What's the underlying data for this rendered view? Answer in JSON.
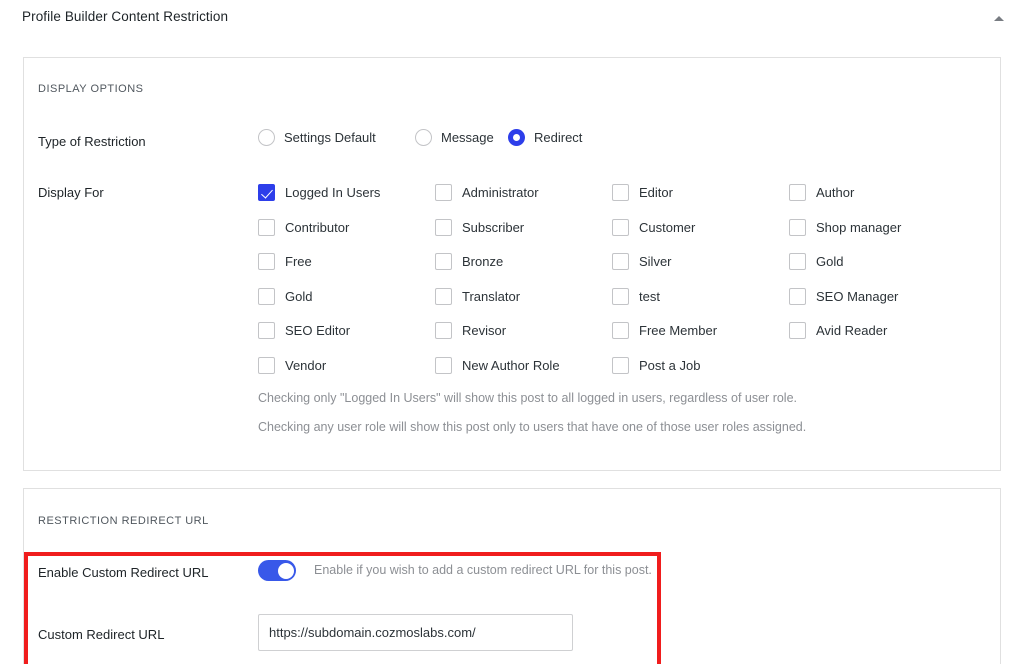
{
  "metabox": {
    "title": "Profile Builder Content Restriction",
    "collapse_icon": "caret-up-icon"
  },
  "display_options": {
    "section_label": "DISPLAY OPTIONS",
    "type_of_restriction": {
      "label": "Type of Restriction",
      "selected": "Redirect",
      "options": [
        {
          "label": "Settings Default",
          "checked": false
        },
        {
          "label": "Message",
          "checked": false
        },
        {
          "label": "Redirect",
          "checked": true
        }
      ]
    },
    "display_for": {
      "label": "Display For",
      "roles": [
        {
          "label": "Logged In Users",
          "checked": true
        },
        {
          "label": "Administrator",
          "checked": false
        },
        {
          "label": "Editor",
          "checked": false
        },
        {
          "label": "Author",
          "checked": false
        },
        {
          "label": "Contributor",
          "checked": false
        },
        {
          "label": "Subscriber",
          "checked": false
        },
        {
          "label": "Customer",
          "checked": false
        },
        {
          "label": "Shop manager",
          "checked": false
        },
        {
          "label": "Free",
          "checked": false
        },
        {
          "label": "Bronze",
          "checked": false
        },
        {
          "label": "Silver",
          "checked": false
        },
        {
          "label": "Gold",
          "checked": false
        },
        {
          "label": "Gold",
          "checked": false
        },
        {
          "label": "Translator",
          "checked": false
        },
        {
          "label": "test",
          "checked": false
        },
        {
          "label": "SEO Manager",
          "checked": false
        },
        {
          "label": "SEO Editor",
          "checked": false
        },
        {
          "label": "Revisor",
          "checked": false
        },
        {
          "label": "Free Member",
          "checked": false
        },
        {
          "label": "Avid Reader",
          "checked": false
        },
        {
          "label": "Vendor",
          "checked": false
        },
        {
          "label": "New Author Role",
          "checked": false
        },
        {
          "label": "Post a Job",
          "checked": false
        }
      ],
      "help_line_1": "Checking only \"Logged In Users\" will show this post to all logged in users, regardless of user role.",
      "help_line_2": "Checking any user role will show this post only to users that have one of those user roles assigned."
    }
  },
  "restriction_redirect_url": {
    "section_label": "RESTRICTION REDIRECT URL",
    "enable_custom_redirect": {
      "label": "Enable Custom Redirect URL",
      "enabled": true,
      "help": "Enable if you wish to add a custom redirect URL for this post."
    },
    "custom_redirect_url": {
      "label": "Custom Redirect URL",
      "value": "https://subdomain.cozmoslabs.com/",
      "placeholder": "https://"
    }
  },
  "annotation": {
    "highlight_color": "#f01d1d"
  },
  "colors": {
    "accent": "#2d3eea",
    "toggle_on": "#3858e9",
    "panel_border": "#e0e0e0",
    "text": "#1d2327",
    "muted_text": "#8c8f94"
  }
}
